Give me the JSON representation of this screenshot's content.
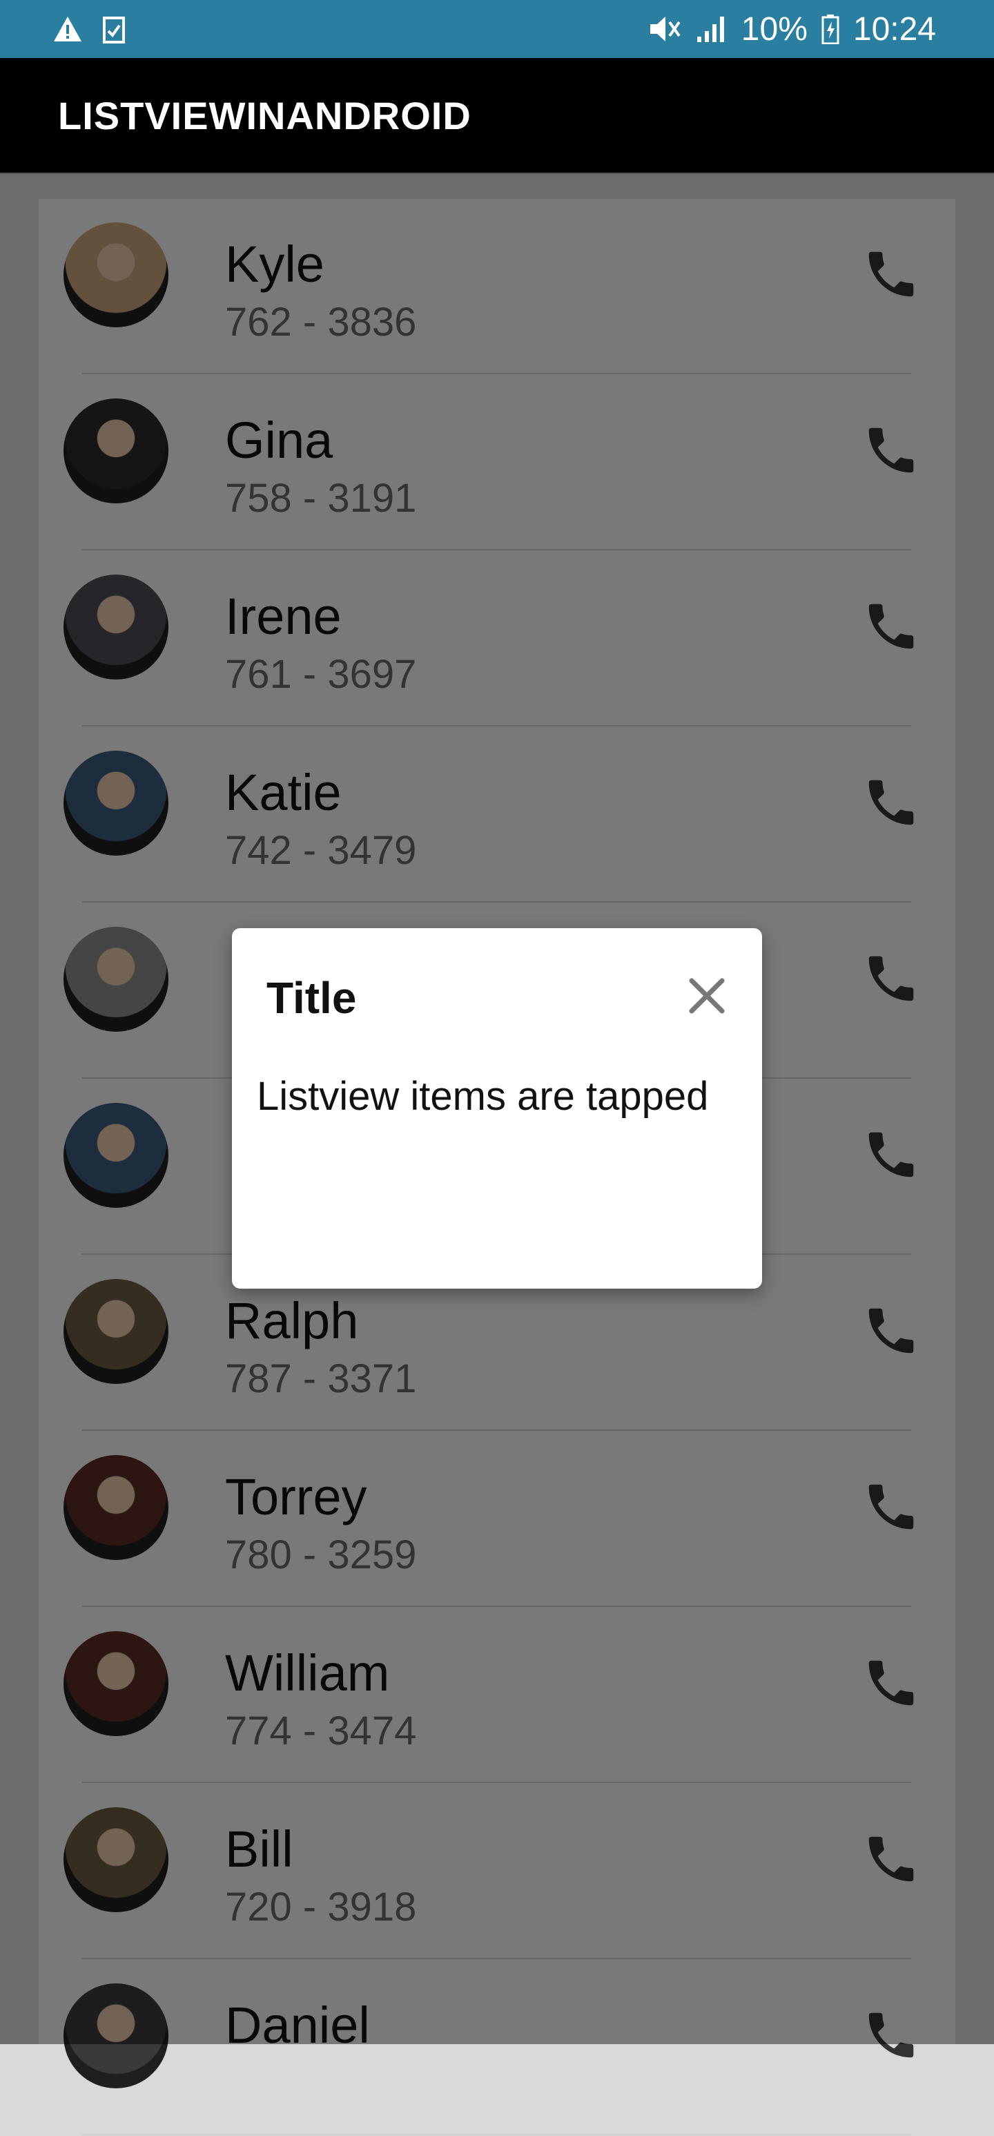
{
  "status_bar": {
    "battery": "10%",
    "time": "10:24",
    "left_icons": [
      "warning-icon",
      "clipboard-check-icon"
    ],
    "right_icons": [
      "mute-icon",
      "signal-icon",
      "battery-charging-icon"
    ],
    "color": "#2a7fa0"
  },
  "app_bar": {
    "title": "LISTVIEWINANDROID"
  },
  "contacts": [
    {
      "name": "Kyle",
      "phone": "762 - 3836",
      "avatar_color": "#c9a27a"
    },
    {
      "name": "Gina",
      "phone": "758 - 3191",
      "avatar_color": "#2b2b2b"
    },
    {
      "name": "Irene",
      "phone": "761 - 3697",
      "avatar_color": "#4a4a55"
    },
    {
      "name": "Katie",
      "phone": "742 - 3479",
      "avatar_color": "#3d5b7a"
    },
    {
      "name": "",
      "phone": "",
      "avatar_color": "#8a8a8a"
    },
    {
      "name": "",
      "phone": "",
      "avatar_color": "#3d5b7a"
    },
    {
      "name": "Ralph",
      "phone": "787 - 3371",
      "avatar_color": "#6b5a3e"
    },
    {
      "name": "Torrey",
      "phone": "780 - 3259",
      "avatar_color": "#5a2a22"
    },
    {
      "name": "William",
      "phone": "774 - 3474",
      "avatar_color": "#5a2a22"
    },
    {
      "name": "Bill",
      "phone": "720 - 3918",
      "avatar_color": "#6b5a3e"
    },
    {
      "name": "Daniel",
      "phone": "",
      "avatar_color": "#3a3a3a"
    }
  ],
  "dialog": {
    "title": "Title",
    "message": "Listview items are tapped",
    "close_icon": "close-icon"
  }
}
